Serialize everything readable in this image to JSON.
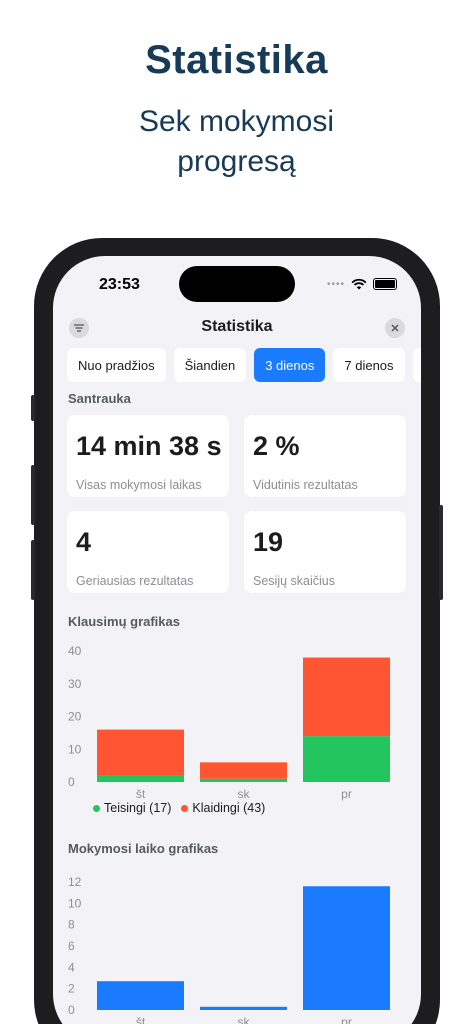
{
  "promo": {
    "title": "Statistika",
    "subtitle_line1": "Sek mokymosi",
    "subtitle_line2": "progresą"
  },
  "status_bar": {
    "time": "23:53"
  },
  "nav": {
    "title": "Statistika"
  },
  "tabs": [
    {
      "label": "Nuo pradžios",
      "active": false
    },
    {
      "label": "Šiandien",
      "active": false
    },
    {
      "label": "3 dienos",
      "active": true
    },
    {
      "label": "7 dienos",
      "active": false
    }
  ],
  "summary": {
    "heading": "Santrauka",
    "cards": [
      {
        "value": "14 min 38 s",
        "label": "Visas mokymosi laikas"
      },
      {
        "value": "2 %",
        "label": "Vidutinis rezultatas"
      },
      {
        "value": "4",
        "label": "Geriausias rezultatas"
      },
      {
        "value": "19",
        "label": "Sesijų skaičius"
      }
    ]
  },
  "questions_chart": {
    "heading": "Klausimų grafikas"
  },
  "time_chart": {
    "heading": "Mokymosi laiko grafikas"
  },
  "colors": {
    "accent": "#1a7bff",
    "correct": "#22c55e",
    "wrong": "#ff5533",
    "title": "#163a57"
  },
  "chart_data": [
    {
      "type": "bar",
      "stacked": true,
      "categories": [
        "št",
        "sk",
        "pr"
      ],
      "series": [
        {
          "name": "Teisingi (17)",
          "values": [
            2,
            1,
            14
          ]
        },
        {
          "name": "Klaidingi (43)",
          "values": [
            14,
            5,
            24
          ]
        }
      ],
      "ylim": [
        0,
        40
      ],
      "yticks": [
        0,
        10,
        20,
        30,
        40
      ],
      "legend": "bottom-left"
    },
    {
      "type": "bar",
      "categories": [
        "št",
        "sk",
        "pr"
      ],
      "values": [
        2.7,
        0.3,
        11.6
      ],
      "ylim": [
        0,
        12
      ],
      "yticks": [
        0,
        2,
        4,
        6,
        8,
        10,
        12
      ]
    }
  ]
}
